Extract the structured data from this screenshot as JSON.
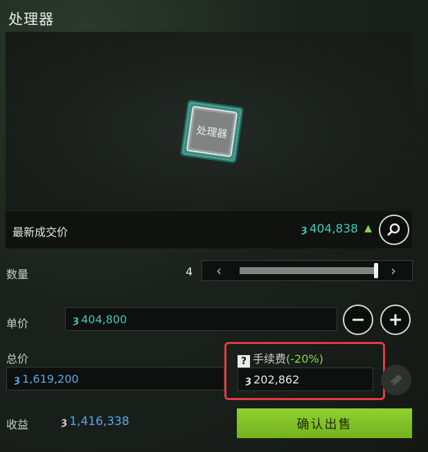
{
  "item": {
    "title": "处理器",
    "chip_text": "处理器"
  },
  "market": {
    "last_price_label": "最新成交价",
    "last_price_value": "404,838",
    "trend": "up-arrow"
  },
  "quantity": {
    "label": "数量",
    "value": "4",
    "slider_fraction": 1.0
  },
  "unit_price": {
    "label": "单价",
    "value": "404,800"
  },
  "total": {
    "label": "总价",
    "value": "1,619,200"
  },
  "fee": {
    "label": "手续费",
    "percent": "(-20%)",
    "value": "202,862"
  },
  "profit": {
    "label": "收益",
    "value": "1,416,338"
  },
  "confirm": {
    "label": "确认出售"
  },
  "icons": {
    "currency": "coin-icon",
    "search": "magnifier-icon",
    "minus": "minus-icon",
    "plus": "plus-icon",
    "help": "question-icon",
    "ticket": "ticket-icon"
  },
  "colors": {
    "accent_green": "#8fd12e",
    "price_teal": "#3fc8b5",
    "value_blue": "#59a8e6",
    "highlight_red": "#e33a45"
  }
}
